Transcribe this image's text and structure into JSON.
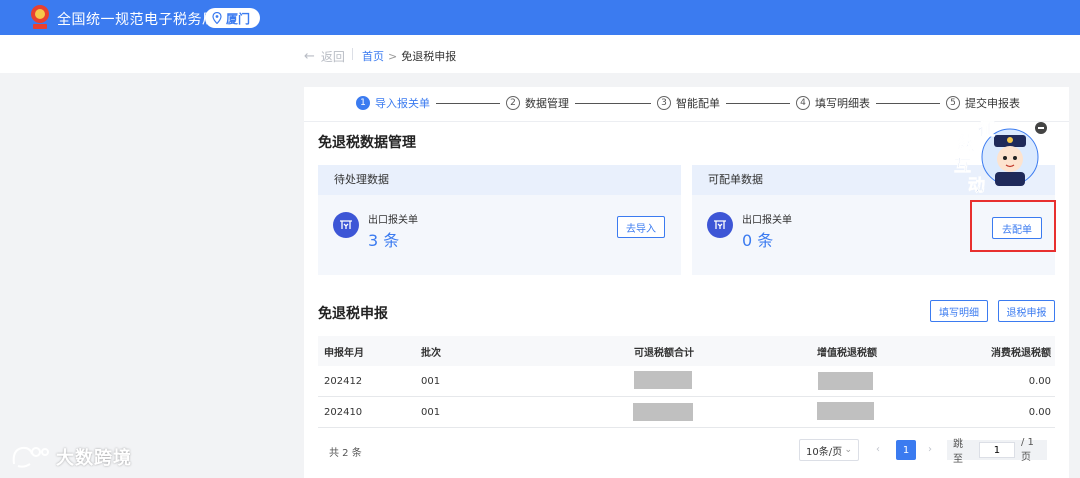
{
  "header": {
    "app_title": "全国统一规范电子税务局",
    "region": "厦门"
  },
  "breadcrumb": {
    "back_label": "返回",
    "home": "首页",
    "separator": ">",
    "current": "免退税申报"
  },
  "steps": [
    {
      "num": "1",
      "label": "导入报关单",
      "active": true
    },
    {
      "num": "2",
      "label": "数据管理",
      "active": false
    },
    {
      "num": "3",
      "label": "智能配单",
      "active": false
    },
    {
      "num": "4",
      "label": "填写明细表",
      "active": false
    },
    {
      "num": "5",
      "label": "提交申报表",
      "active": false
    }
  ],
  "data_section": {
    "title": "免退税数据管理",
    "pending": {
      "header": "待处理数据",
      "label": "出口报关单",
      "count": "3 条",
      "button": "去导入"
    },
    "matchable": {
      "header": "可配单数据",
      "label": "出口报关单",
      "count": "0 条",
      "button": "去配单"
    }
  },
  "declare_section": {
    "title": "免退税申报",
    "btn_fill_detail": "填写明细",
    "btn_withdraw": "退税申报"
  },
  "table": {
    "columns": [
      "申报年月",
      "批次",
      "可退税额合计",
      "增值税退税额",
      "消费税退税额"
    ],
    "rows": [
      {
        "period": "202412",
        "batch": "001",
        "refundable": "",
        "vat": "",
        "consumption": "0.00"
      },
      {
        "period": "202410",
        "batch": "001",
        "refundable": "",
        "vat": "",
        "consumption": "0.00"
      }
    ]
  },
  "pagination": {
    "total": "共 2 条",
    "page_size": "10条/页",
    "current_page": "1",
    "jump_label": "跳至",
    "jump_value": "1",
    "page_total": "/ 1 页"
  },
  "mascot": {
    "text": [
      "征",
      "纳",
      "互",
      "动"
    ]
  },
  "watermark": "大数跨境",
  "colors": {
    "primary": "#3b7bf0",
    "icon_bg": "#3d56d6",
    "highlight": "#e8302f"
  }
}
